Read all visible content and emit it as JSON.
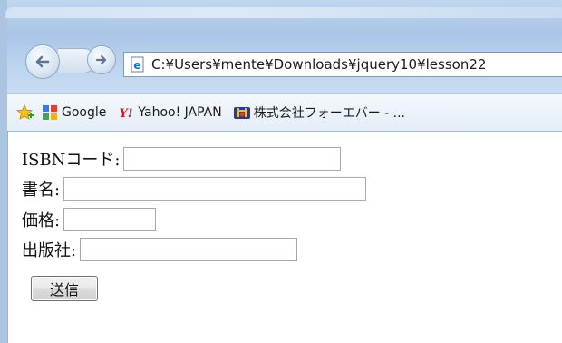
{
  "browser": {
    "address": "C:¥Users¥mente¥Downloads¥jquery10¥lesson22",
    "icons": {
      "back": "back-arrow-icon",
      "forward": "forward-arrow-icon",
      "page": "ie-page-icon"
    }
  },
  "favorites": {
    "items": [
      {
        "label": "",
        "icon": "favorites-star-icon"
      },
      {
        "label": "Google",
        "icon": "google-icon"
      },
      {
        "label": "Yahoo! JAPAN",
        "icon": "yahoo-icon"
      },
      {
        "label": "株式会社フォーエバー - ...",
        "icon": "forever-icon"
      }
    ]
  },
  "form": {
    "isbn_label": "ISBNコード:",
    "isbn_value": "",
    "title_label": "書名:",
    "title_value": "",
    "price_label": "価格:",
    "price_value": "",
    "publisher_label": "出版社:",
    "publisher_value": "",
    "submit_label": "送信"
  }
}
